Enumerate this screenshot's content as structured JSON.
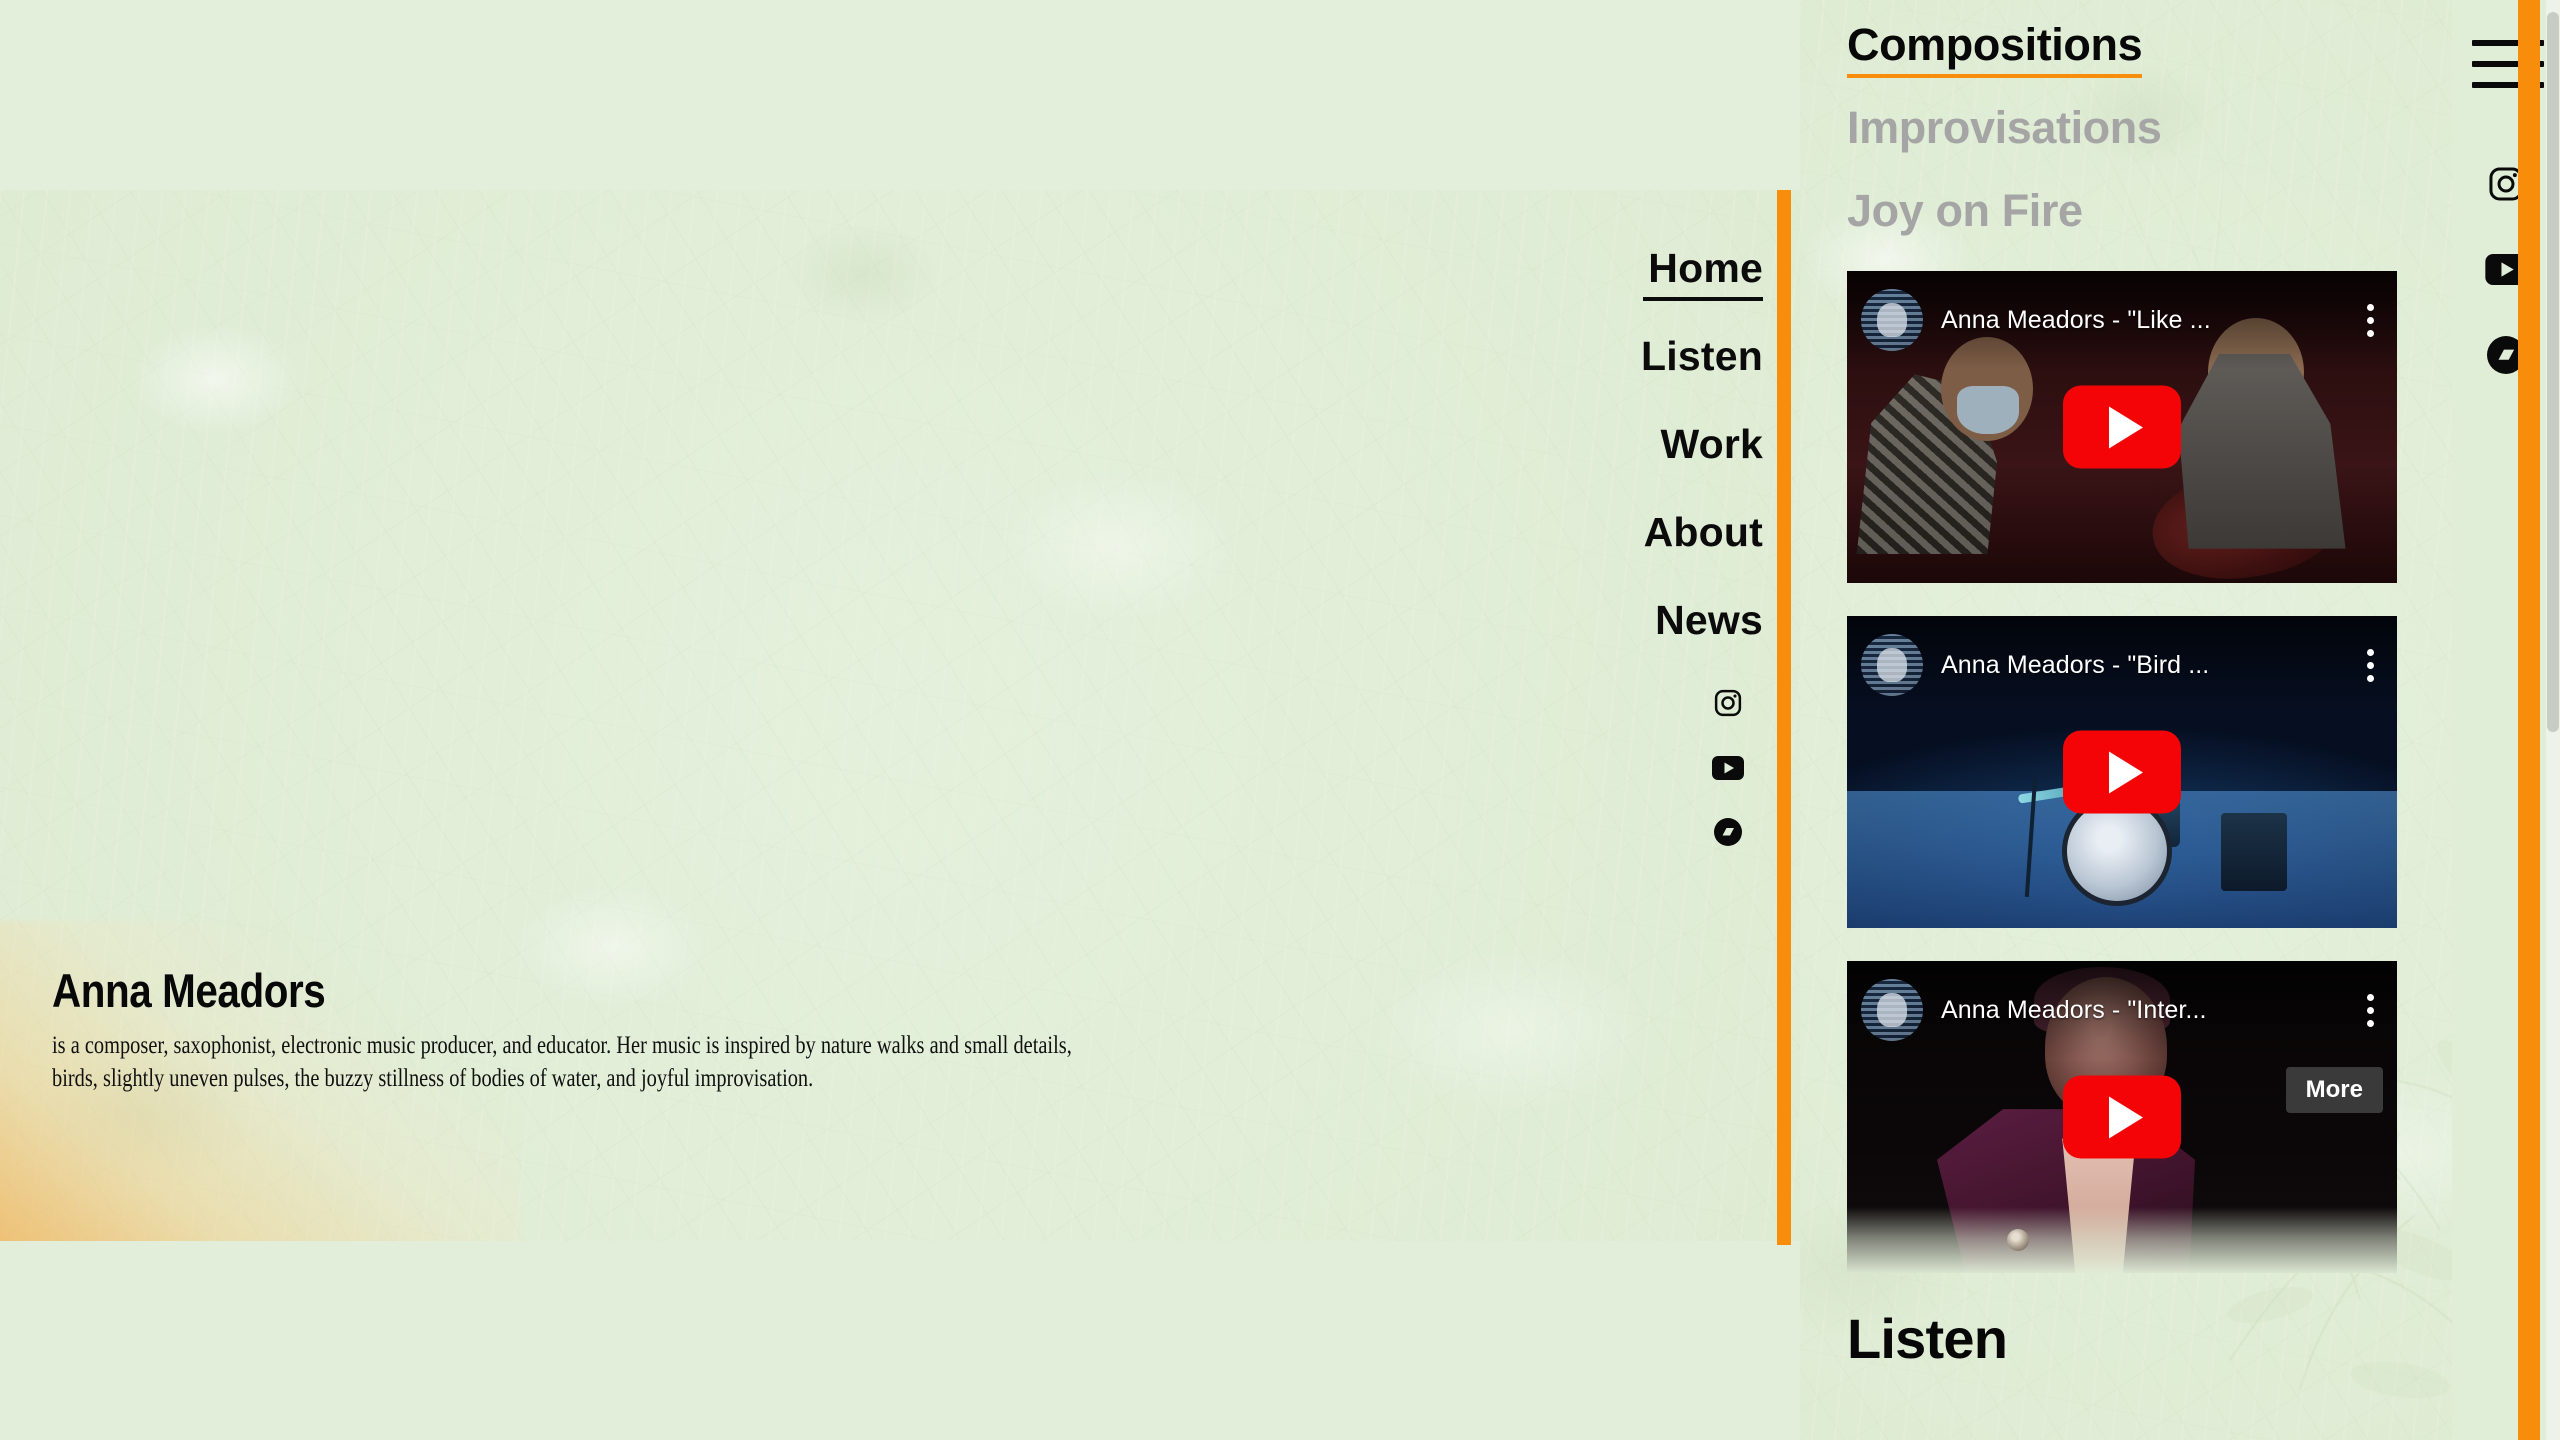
{
  "site": {
    "background_color": "#e1eed7",
    "accent_color": "#f78d0a",
    "text_color": "#0b0b0b",
    "muted_color": "#a5a5a5"
  },
  "main_nav": {
    "items": [
      {
        "label": "Home",
        "active": true
      },
      {
        "label": "Listen",
        "active": false
      },
      {
        "label": "Work",
        "active": false
      },
      {
        "label": "About",
        "active": false
      },
      {
        "label": "News",
        "active": false
      }
    ],
    "social": [
      {
        "icon": "instagram-icon",
        "name": "Instagram"
      },
      {
        "icon": "youtube-icon",
        "name": "YouTube"
      },
      {
        "icon": "bandcamp-icon",
        "name": "Bandcamp"
      }
    ]
  },
  "bio": {
    "name": "Anna Meadors",
    "description": "is a composer, saxophonist, electronic music producer, and educator. Her music is inspired by nature walks and small details, birds, slightly uneven pulses, the buzzy stillness of bodies of water, and joyful improvisation."
  },
  "right_panel": {
    "tabs": [
      {
        "label": "Compositions",
        "active": true
      },
      {
        "label": "Improvisations",
        "active": false
      },
      {
        "label": "Joy on Fire",
        "active": false
      }
    ],
    "videos": [
      {
        "title": "Anna Meadors - \"Like ...",
        "channel_avatar": "channel-avatar",
        "play_label": "Play",
        "more_label": "More",
        "show_tooltip": false,
        "scene": "sc1"
      },
      {
        "title": "Anna Meadors - \"Bird ...",
        "channel_avatar": "channel-avatar",
        "play_label": "Play",
        "more_label": "More",
        "show_tooltip": false,
        "scene": "sc2"
      },
      {
        "title": "Anna Meadors - \"Inter...",
        "channel_avatar": "channel-avatar",
        "play_label": "Play",
        "more_label": "More",
        "show_tooltip": true,
        "scene": "sc3"
      }
    ],
    "section_heading": "Listen"
  },
  "rail": {
    "menu_label": "Menu",
    "social": [
      {
        "icon": "instagram-icon",
        "name": "Instagram"
      },
      {
        "icon": "youtube-icon",
        "name": "YouTube"
      },
      {
        "icon": "bandcamp-icon",
        "name": "Bandcamp"
      }
    ]
  }
}
